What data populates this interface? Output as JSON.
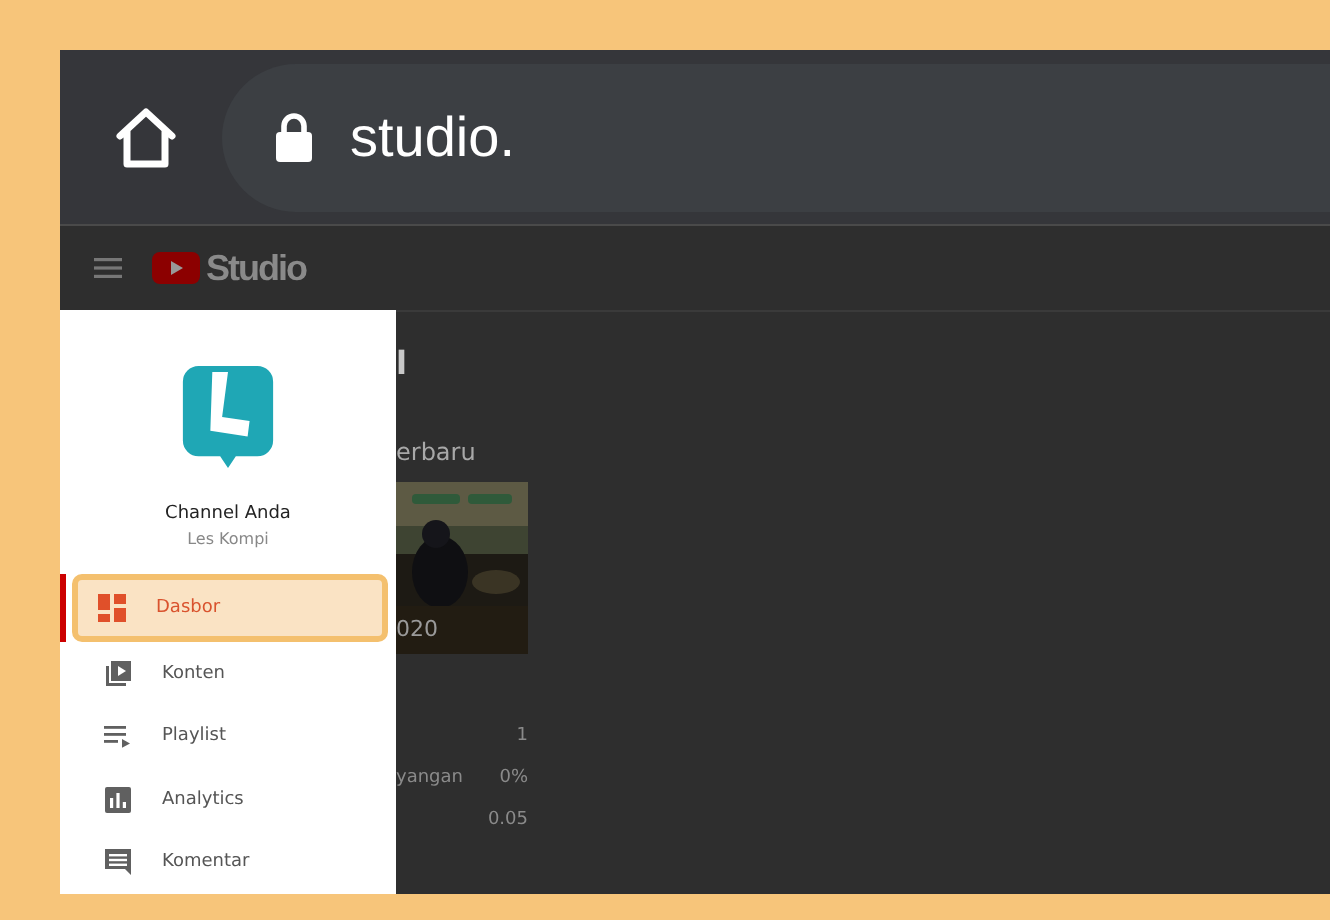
{
  "browser": {
    "url": "studio."
  },
  "studio_header": {
    "logo_text": "Studio"
  },
  "background_page": {
    "title_fragment": "l",
    "section_fragment": "erbaru",
    "thumbnail_caption": "020",
    "stats": [
      {
        "value": "1"
      },
      {
        "label": "yangan",
        "value": "0%"
      },
      {
        "value": "0.05"
      }
    ]
  },
  "drawer": {
    "channel_title": "Channel Anda",
    "channel_name": "Les Kompi",
    "items": [
      {
        "label": "Dasbor",
        "kind": "dashboard",
        "selected": true
      },
      {
        "label": "Konten",
        "kind": "content",
        "selected": false
      },
      {
        "label": "Playlist",
        "kind": "playlist",
        "selected": false
      },
      {
        "label": "Analytics",
        "kind": "analytics",
        "selected": false
      },
      {
        "label": "Komentar",
        "kind": "comments",
        "selected": false
      }
    ]
  }
}
